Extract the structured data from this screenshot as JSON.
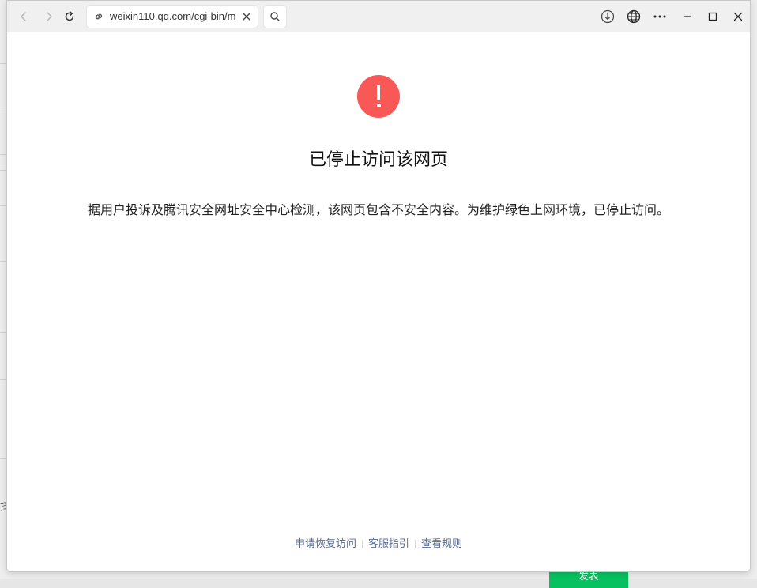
{
  "browser": {
    "url": "weixin110.qq.com/cgi-bin/m",
    "buttons": {
      "back": "back-icon",
      "forward": "forward-icon",
      "reload": "reload-icon",
      "clear": "close-icon",
      "search": "search-icon",
      "download": "download-icon",
      "translate": "globe-icon",
      "more": "more-icon",
      "minimize": "minimize-icon",
      "maximize": "maximize-icon",
      "close": "close-icon"
    }
  },
  "page": {
    "icon": "exclamation-icon",
    "icon_color": "#f85956",
    "title": "已停止访问该网页",
    "description": "据用户投诉及腾讯安全网址安全中心检测，该网页包含不安全内容。为维护绿色上网环境，已停止访问。",
    "links": [
      "申请恢复访问",
      "客服指引",
      "查看规则"
    ],
    "link_color": "#576b95"
  },
  "background_app": {
    "side_text": "择",
    "button_label": "发表",
    "button_color": "#07c160"
  }
}
